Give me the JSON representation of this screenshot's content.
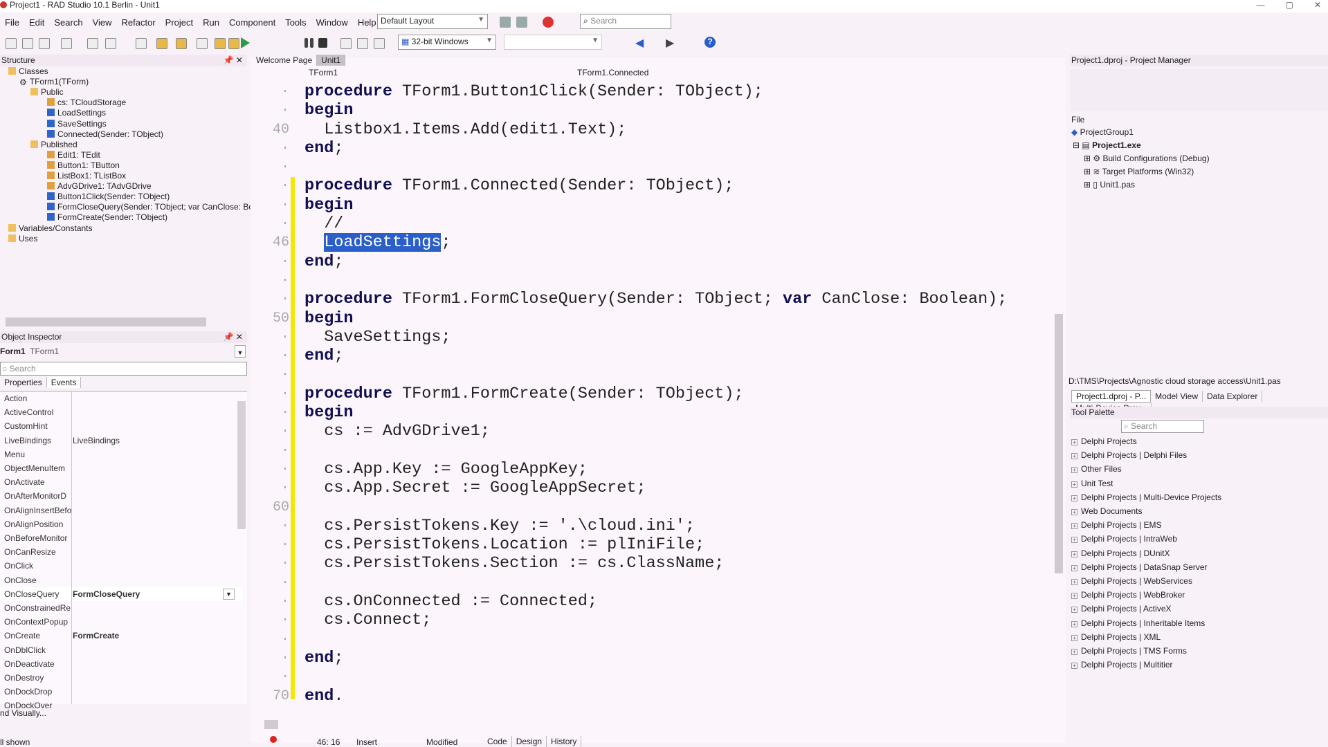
{
  "window": {
    "title": "Project1 - RAD Studio 10.1 Berlin - Unit1"
  },
  "menu": [
    "File",
    "Edit",
    "Search",
    "View",
    "Refactor",
    "Project",
    "Run",
    "Component",
    "Tools",
    "Window",
    "Help"
  ],
  "toolbar": {
    "layout": "Default Layout",
    "search_placeholder": "Search",
    "platform": "32-bit Windows",
    "config": ""
  },
  "structure": {
    "title": "Structure",
    "items": [
      {
        "label": "Classes",
        "icon": "folder",
        "level": 0
      },
      {
        "label": "TForm1(TForm)",
        "icon": "class-gear",
        "level": 1
      },
      {
        "label": "Public",
        "icon": "folder",
        "level": 2
      },
      {
        "label": "cs: TCloudStorage",
        "icon": "field",
        "level": 3
      },
      {
        "label": "LoadSettings",
        "icon": "method",
        "level": 3
      },
      {
        "label": "SaveSettings",
        "icon": "method",
        "level": 3
      },
      {
        "label": "Connected(Sender: TObject)",
        "icon": "method",
        "level": 3
      },
      {
        "label": "Published",
        "icon": "folder",
        "level": 2
      },
      {
        "label": "Edit1: TEdit",
        "icon": "field",
        "level": 3
      },
      {
        "label": "Button1: TButton",
        "icon": "field",
        "level": 3
      },
      {
        "label": "ListBox1: TListBox",
        "icon": "field",
        "level": 3
      },
      {
        "label": "AdvGDrive1: TAdvGDrive",
        "icon": "field",
        "level": 3
      },
      {
        "label": "Button1Click(Sender: TObject)",
        "icon": "method",
        "level": 3
      },
      {
        "label": "FormCloseQuery(Sender: TObject; var CanClose: Bo",
        "icon": "method",
        "level": 3
      },
      {
        "label": "FormCreate(Sender: TObject)",
        "icon": "method",
        "level": 3
      },
      {
        "label": "Variables/Constants",
        "icon": "folder",
        "level": 0
      },
      {
        "label": "Uses",
        "icon": "folder",
        "level": 0
      }
    ]
  },
  "inspector": {
    "title": "Object Inspector",
    "object_name": "Form1",
    "object_type": "TForm1",
    "search_placeholder": "Search",
    "tabs": [
      "Properties",
      "Events"
    ],
    "rows": [
      [
        "Action",
        ""
      ],
      [
        "ActiveControl",
        ""
      ],
      [
        "CustomHint",
        ""
      ],
      [
        "LiveBindings",
        "LiveBindings"
      ],
      [
        "Menu",
        ""
      ],
      [
        "ObjectMenuItem",
        ""
      ],
      [
        "OnActivate",
        ""
      ],
      [
        "OnAfterMonitorD",
        ""
      ],
      [
        "OnAlignInsertBefo",
        ""
      ],
      [
        "OnAlignPosition",
        ""
      ],
      [
        "OnBeforeMonitor",
        ""
      ],
      [
        "OnCanResize",
        ""
      ],
      [
        "OnClick",
        ""
      ],
      [
        "OnClose",
        ""
      ],
      [
        "OnCloseQuery",
        "FormCloseQuery"
      ],
      [
        "OnConstrainedRe",
        ""
      ],
      [
        "OnContextPopup",
        ""
      ],
      [
        "OnCreate",
        "FormCreate"
      ],
      [
        "OnDblClick",
        ""
      ],
      [
        "OnDeactivate",
        ""
      ],
      [
        "OnDestroy",
        ""
      ],
      [
        "OnDockDrop",
        ""
      ],
      [
        "OnDockOver",
        ""
      ]
    ],
    "footer_link": "nd Visually...",
    "footer_status": "ll shown"
  },
  "editor": {
    "tabs": [
      "Welcome Page",
      "Unit1"
    ],
    "class_combo": "TForm1",
    "method_combo": "TForm1.Connected",
    "line_numbers": {
      "40": "40",
      "46": "46",
      "50": "50",
      "60": "60",
      "70": "70"
    },
    "lines": [
      "procedure TForm1.Button1Click(Sender: TObject);",
      "begin",
      "  Listbox1.Items.Add(edit1.Text);",
      "end;",
      "",
      "procedure TForm1.Connected(Sender: TObject);",
      "begin",
      "  //",
      "  LoadSettings;",
      "end;",
      "",
      "procedure TForm1.FormCloseQuery(Sender: TObject; var CanClose: Boolean);",
      "begin",
      "  SaveSettings;",
      "end;",
      "",
      "procedure TForm1.FormCreate(Sender: TObject);",
      "begin",
      "  cs := AdvGDrive1;",
      "",
      "  cs.App.Key := GoogleAppKey;",
      "  cs.App.Secret := GoogleAppSecret;",
      "",
      "  cs.PersistTokens.Key := '.\\cloud.ini';",
      "  cs.PersistTokens.Location := plIniFile;",
      "  cs.PersistTokens.Section := cs.ClassName;",
      "",
      "  cs.OnConnected := Connected;",
      "  cs.Connect;",
      "",
      "end;",
      "",
      "end."
    ],
    "status": {
      "position": "46: 16",
      "mode": "Insert",
      "state": "Modified"
    },
    "view_tabs": [
      "Code",
      "Design",
      "History"
    ]
  },
  "project_manager": {
    "title": "Project1.dproj - Project Manager",
    "column": "File",
    "group": "ProjectGroup1",
    "project": "Project1.exe",
    "children": [
      "Build Configurations (Debug)",
      "Target Platforms (Win32)",
      "Unit1.pas"
    ],
    "path": "D:\\TMS\\Projects\\Agnostic cloud storage access\\Unit1.pas",
    "tabs": [
      "Project1.dproj - P...",
      "Model View",
      "Data Explorer",
      "Multi-Device Prev..."
    ]
  },
  "tool_palette": {
    "title": "Tool Palette",
    "search_placeholder": "Search",
    "items": [
      "Delphi Projects",
      "Delphi Projects | Delphi Files",
      "Other Files",
      "Unit Test",
      "Delphi Projects | Multi-Device Projects",
      "Web Documents",
      "Delphi Projects | EMS",
      "Delphi Projects | IntraWeb",
      "Delphi Projects | DUnitX",
      "Delphi Projects | DataSnap Server",
      "Delphi Projects | WebServices",
      "Delphi Projects | WebBroker",
      "Delphi Projects | ActiveX",
      "Delphi Projects | Inheritable Items",
      "Delphi Projects | XML",
      "Delphi Projects | TMS Forms",
      "Delphi Projects | Multitier"
    ]
  },
  "colors": {
    "selection": "#2a5ec8",
    "modified_bar": "#f5e800",
    "background": "#f8f1f8"
  }
}
